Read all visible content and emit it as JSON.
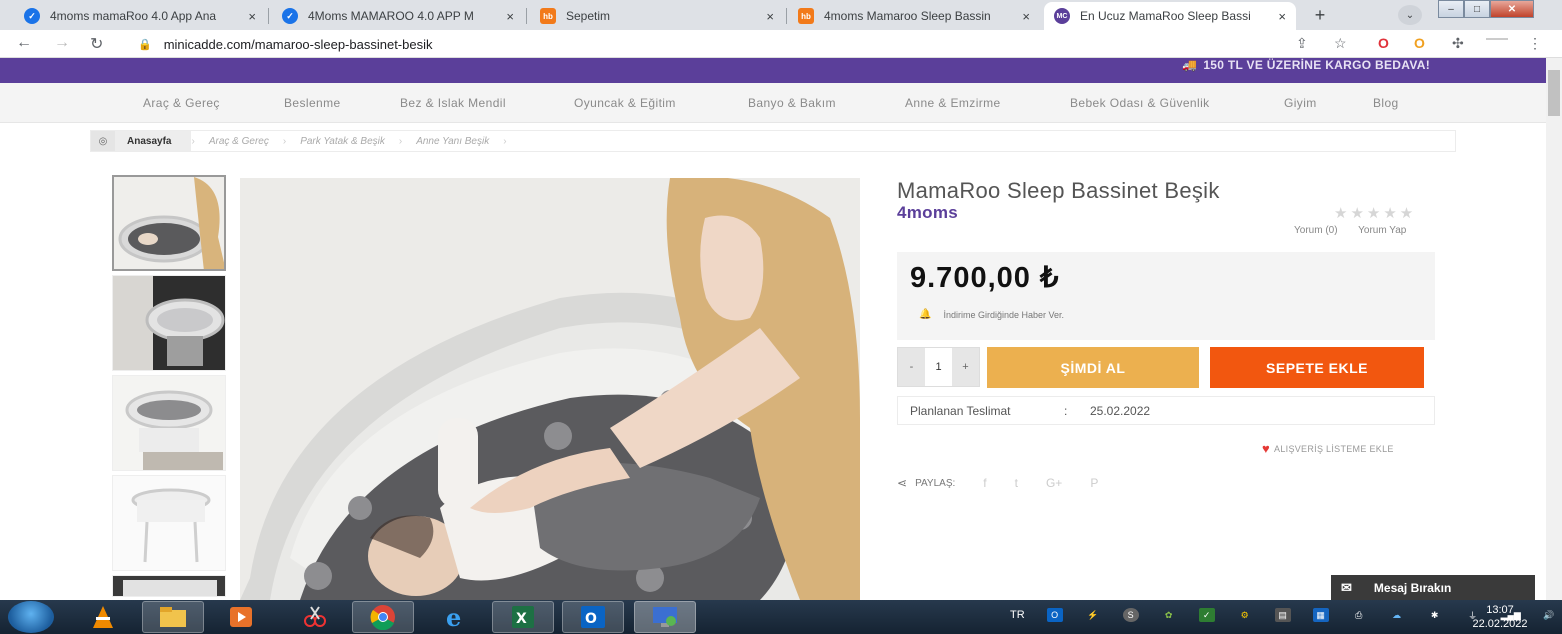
{
  "browser": {
    "tabs": [
      {
        "title": "4moms mamaRoo 4.0 App Ana",
        "icon": "check-favicon"
      },
      {
        "title": "4Moms MAMAROO 4.0 APP M",
        "icon": "check-favicon"
      },
      {
        "title": "Sepetim",
        "icon": "hb-favicon"
      },
      {
        "title": "4moms Mamaroo Sleep Bassin",
        "icon": "hb-favicon"
      },
      {
        "title": "En Ucuz MamaRoo Sleep Bassi",
        "icon": "mc-favicon"
      }
    ],
    "favicons": {
      "hb": "hb",
      "mc": "MC"
    },
    "tab_close": "×",
    "new_tab": "+",
    "url": "minicadde.com/mamaroo-sleep-bassinet-besik"
  },
  "site": {
    "shipping_banner": "150 TL VE ÜZERİNE KARGO BEDAVA!",
    "categories": [
      "Araç & Gereç",
      "Beslenme",
      "Bez & Islak Mendil",
      "Oyuncak & Eğitim",
      "Banyo & Bakım",
      "Anne & Emzirme",
      "Bebek Odası & Güvenlik",
      "Giyim",
      "Blog"
    ],
    "breadcrumb": [
      "Anasayfa",
      "Araç & Gereç",
      "Park Yatak & Beşik",
      "Anne Yanı Beşik"
    ]
  },
  "product": {
    "name": "MamaRoo Sleep Bassinet Beşik",
    "brand": "4moms",
    "rating": 0,
    "stars": "★★★★★",
    "review_count_label": "Yorum (0)",
    "write_review_label": "Yorum Yap",
    "price": "9.700,00 ₺",
    "notify_label": "İndirime Girdiğinde Haber Ver.",
    "quantity": "1",
    "minus": "-",
    "plus": "+",
    "buy_now_label": "ŞİMDİ AL",
    "add_to_cart_label": "SEPETE EKLE",
    "delivery_label": "Planlanan Teslimat",
    "delivery_colon": ":",
    "delivery_date": "25.02.2022",
    "wishlist_label": "ALIŞVERİŞ LİSTEME EKLE",
    "share_label": "PAYLAŞ:",
    "social": [
      "f",
      "t",
      "G+",
      "P"
    ]
  },
  "chat": {
    "label": "Mesaj Bırakın"
  },
  "taskbar": {
    "lang": "TR",
    "time": "13:07",
    "date": "22.02.2022"
  },
  "colors": {
    "brand_purple": "#5b3f9a",
    "buy_now": "#ecb04f",
    "add_to_cart": "#f2570f"
  }
}
